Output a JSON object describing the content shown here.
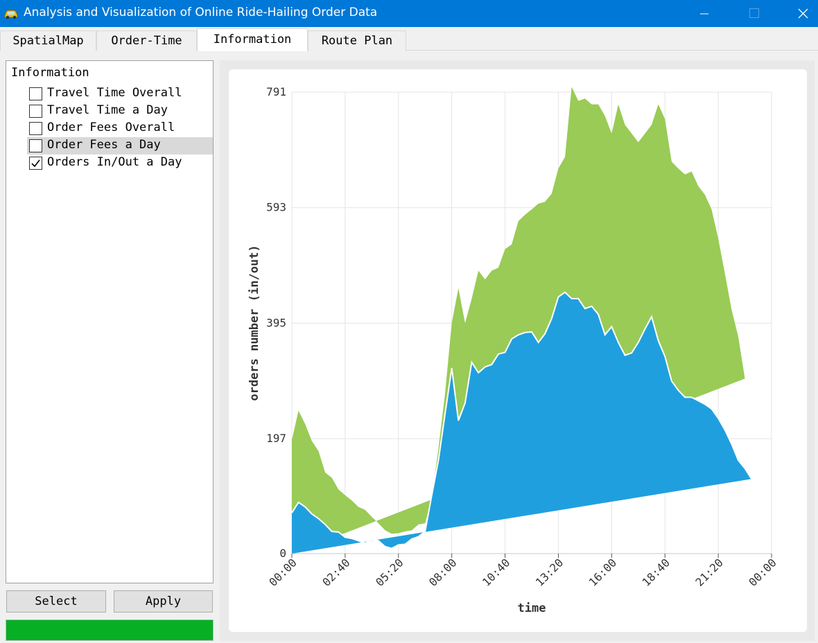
{
  "window": {
    "title": "Analysis and Visualization of Online Ride-Hailing Order Data",
    "app_icon": "taxi-car-icon"
  },
  "tabs": [
    {
      "label": "SpatialMap",
      "active": false
    },
    {
      "label": "Order-Time",
      "active": false
    },
    {
      "label": "Information",
      "active": true
    },
    {
      "label": "Route Plan",
      "active": false
    }
  ],
  "sidebar": {
    "header": "Information",
    "items": [
      {
        "label": "Travel Time Overall",
        "checked": false,
        "highlighted": false
      },
      {
        "label": "Travel Time a Day",
        "checked": false,
        "highlighted": false
      },
      {
        "label": "Order Fees Overall",
        "checked": false,
        "highlighted": false
      },
      {
        "label": "Order Fees a Day",
        "checked": false,
        "highlighted": true
      },
      {
        "label": "Orders In/Out a Day",
        "checked": true,
        "highlighted": false
      }
    ],
    "select_label": "Select",
    "apply_label": "Apply",
    "progress": 1.0
  },
  "colors": {
    "title_bar": "#0078d7",
    "series_in": "#209fdf",
    "series_out": "#99cb56",
    "progress": "#06b025",
    "grid": "#e4e4e4"
  },
  "chart_data": {
    "type": "area",
    "stacked": true,
    "xlabel": "time",
    "ylabel": "orders number (in/out)",
    "ylim": [
      0,
      791
    ],
    "yticks": [
      "0",
      "197",
      "395",
      "593",
      "791"
    ],
    "xlim": [
      "00:00",
      "24:00"
    ],
    "xticks": [
      "00:00",
      "02:40",
      "05:20",
      "08:00",
      "10:40",
      "13:20",
      "16:00",
      "18:40",
      "21:20",
      "00:00"
    ],
    "grid": true,
    "x": [
      "00:00",
      "00:20",
      "00:40",
      "01:00",
      "01:20",
      "01:40",
      "02:00",
      "02:20",
      "02:40",
      "03:00",
      "03:20",
      "03:40",
      "04:00",
      "04:20",
      "04:40",
      "05:00",
      "05:20",
      "05:40",
      "06:00",
      "06:20",
      "06:40",
      "07:00",
      "07:20",
      "07:40",
      "08:00",
      "08:20",
      "08:40",
      "09:00",
      "09:20",
      "09:40",
      "10:00",
      "10:20",
      "10:40",
      "11:00",
      "11:20",
      "11:40",
      "12:00",
      "12:20",
      "12:40",
      "13:00",
      "13:20",
      "13:40",
      "14:00",
      "14:20",
      "14:40",
      "15:00",
      "15:20",
      "15:40",
      "16:00",
      "16:20",
      "16:40",
      "17:00",
      "17:20",
      "17:40",
      "18:00",
      "18:20",
      "18:40",
      "19:00",
      "19:20",
      "19:40",
      "20:00",
      "20:20",
      "20:40",
      "21:00",
      "21:20",
      "21:40",
      "22:00",
      "22:20",
      "22:40",
      "23:00",
      "23:20",
      "23:40",
      "24:00"
    ],
    "series": [
      {
        "values": [
          70,
          88,
          80,
          68,
          60,
          50,
          38,
          37,
          28,
          26,
          22,
          18,
          24,
          22,
          12,
          9,
          15,
          16,
          25,
          29,
          38,
          100,
          160,
          240,
          318,
          228,
          258,
          328,
          310,
          320,
          324,
          342,
          345,
          368,
          375,
          379,
          380,
          362,
          377,
          403,
          440,
          448,
          437,
          437,
          420,
          424,
          410,
          375,
          389,
          362,
          340,
          344,
          362,
          385,
          406,
          365,
          338,
          296,
          280,
          268,
          268,
          262,
          256,
          248,
          232,
          212,
          188,
          160,
          146,
          128
        ],
        "totals": [
          195,
          245,
          222,
          193,
          176,
          139,
          130,
          110,
          100,
          91,
          80,
          75,
          63,
          52,
          40,
          34,
          35,
          38,
          40,
          50,
          52,
          95,
          180,
          275,
          395,
          455,
          395,
          437,
          485,
          470,
          485,
          490,
          522,
          530,
          570,
          581,
          590,
          600,
          603,
          617,
          660,
          680,
          800,
          776,
          780,
          770,
          770,
          750,
          720,
          770,
          735,
          720,
          705,
          720,
          735,
          770,
          745,
          672,
          660,
          650,
          655,
          630,
          615,
          590,
          540,
          480,
          418,
          372,
          300
        ],
        "note": "totals is cumulative (in + out)"
      }
    ]
  }
}
